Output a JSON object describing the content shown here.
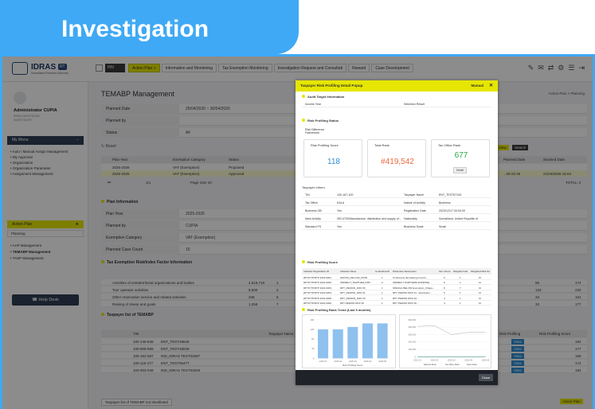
{
  "banner": {
    "title": "Investigation"
  },
  "logo": {
    "name": "IDRAS",
    "badge": "RT",
    "subtitle": "Somaliland Revenue Authority"
  },
  "top_nav": {
    "badge": "INV",
    "tabs": [
      {
        "label": "Action Plan >",
        "active": true
      },
      {
        "label": "Information and Monitoring",
        "active": false
      },
      {
        "label": "Tax Exemption Monitoring",
        "active": false
      },
      {
        "label": "Investigation Request and Consultati",
        "active": false
      },
      {
        "label": "Reward",
        "active": false
      },
      {
        "label": "Case Development",
        "active": false
      }
    ]
  },
  "sidebar": {
    "user_name": "Administrator CUPIA",
    "user_sub": [
      "IDRAS INVESTIGAS",
      "INVESTIGATE"
    ],
    "my_menu": "My Menu",
    "menu_items": [
      "Auto / Manual Assign Management",
      "My Approval",
      "Organization",
      "Organization Parameter",
      "Assignment Management"
    ],
    "action_plan": "Action Plan",
    "planning": "Planning",
    "sub_items": [
      "AAP Management",
      "TEMABP Management",
      "TASP Management"
    ],
    "help_desk": "Help Desk"
  },
  "main": {
    "title": "TEMABP Management",
    "breadcrumb": "Action Plan > Planning",
    "filters": [
      {
        "label": "Planned Date",
        "value": "25/04/2026 ~ 30/04/2026"
      },
      {
        "label": "Planned by",
        "value": ""
      },
      {
        "label": "Status",
        "value": "All"
      }
    ],
    "reset": "Reset",
    "view_btn": "View",
    "search_btn": "Search",
    "grid_headers": [
      "Plan Year",
      "Exemption Category",
      "Status",
      "Planned Date",
      "Stocked Date"
    ],
    "grid_rows": [
      [
        "2025-2026",
        "VAT (Exemption)",
        "Proposed",
        "",
        ""
      ],
      [
        "2025-2026",
        "VAT (Exemption)",
        "Approved",
        "...09 02:45",
        "21/04/2026 15:04"
      ]
    ],
    "pager": "1/1",
    "page_size": "Page Size 10",
    "total": "TOTAL: 2",
    "plan_info_title": "Plan Information",
    "plan_info": [
      {
        "label": "Plan Year",
        "value": "2025-2026"
      },
      {
        "label": "Planned by",
        "value": "CUPIA"
      },
      {
        "label": "Exemption Category",
        "value": "VAT (Exemption)"
      },
      {
        "label": "Planned Case Count",
        "value": "15"
      }
    ],
    "risk_factor_title": "Tax Exemption Risk/Index Factor Information",
    "risk_factors": [
      {
        "name": "Activities of extraterritorial organizations and bodies",
        "v1": "4,516,719",
        "v2": "1",
        "v3": "96",
        "v4": "174"
      },
      {
        "name": "Tour operator activities",
        "v1": "8,830",
        "v2": "2",
        "v3": "132",
        "v4": "232"
      },
      {
        "name": "Other reservation service and related activities",
        "v1": "348",
        "v2": "6",
        "v3": "33",
        "v4": "161"
      },
      {
        "name": "Raising of sheep and goats",
        "v1": "1,258",
        "v2": "7",
        "v3": "33",
        "v4": "177"
      }
    ],
    "taxpayer_title": "Taxpayer list of TEMABP",
    "taxpayer_headers": [
      "TIN",
      "Taxpayer Name",
      "Risk Profiling",
      "Risk Profiling Score"
    ],
    "taxpayers": [
      {
        "tin": "100-146-846",
        "name": "ENT_TEST48846",
        "score": "182"
      },
      {
        "tin": "100-909-899",
        "name": "ENT_TEST48049",
        "score": "177"
      },
      {
        "tin": "100-152-587",
        "name": "IND_IDRAS TEST02587",
        "score": "166"
      },
      {
        "tin": "100-115-477",
        "name": "ENT_TEST06477",
        "score": "174"
      },
      {
        "tin": "103-903-049",
        "name": "IND_IDRAS TEST03049",
        "score": "182"
      }
    ],
    "view_label": "View",
    "bottom_link": "Taxpayer list of TEMABP not shortlisted",
    "action_plan_btn": "Action Plan"
  },
  "modal": {
    "title": "Taxpayer Risk Profiling Detail Popup",
    "help": "Manual",
    "audit_title": "Audit Target Information",
    "audit_fields": [
      {
        "label": "Income Year",
        "value": ""
      },
      {
        "label": "Selection Result",
        "value": ""
      }
    ],
    "risk_status_title": "Risk Profiling Status",
    "diff_label": "Risk Difference Framework",
    "cards": [
      {
        "title": "Risk Profiling Score",
        "value": "118",
        "color": "#2d8fd6"
      },
      {
        "title": "Total Rank",
        "value": "#419,542",
        "color": "#f06a3c"
      },
      {
        "title": "Tax Office Rank",
        "value": "677",
        "color": "#2aa84a"
      }
    ],
    "detail_btn": "Detail",
    "taxpayer_info_title": "Taxpayer Inform",
    "info_rows": [
      [
        "TIN",
        "100-167-100",
        "Taxpayer Name",
        "ENT_TEST67100"
      ],
      [
        "Tax Office",
        "KALA",
        "Nature of Activity",
        "Business"
      ],
      [
        "Business OB",
        "Yes",
        "Registration Date",
        "2023/12/17 00:00:00"
      ],
      [
        "Main Activity",
        "ISIC4700/Manufacture, distribution and supply of...",
        "Nationality",
        "Somaliland, United Republic of"
      ],
      [
        "Standard FS",
        "Yes",
        "Business Scale",
        "Small"
      ]
    ],
    "score_title": "Risk Profiling Score",
    "score_headers": [
      "Indicator Registration ID",
      "Indicator Name",
      "Controlled Response",
      "Parameter Description",
      "Item Score",
      "Weighted Value",
      "Weighted Risk Score"
    ],
    "score_rows": [
      [
        "RPTP.ITP/RTP 2023-0001",
        "GROSS_DECLAR_RATE",
        "1",
        "Continuous decreasing trend fo...",
        "6",
        "1",
        "10"
      ],
      [
        "RPTP.ITP/RTP 2023-0002",
        "INDIRECT_PARTNER_PMT...",
        "0",
        "INDIRECT PARTNERS EXPENSE...",
        "6",
        "1",
        "10"
      ],
      [
        "RPTP.ITP/RTP 2023-0003",
        "RPT_PERIOD_DIFF 06",
        "1",
        "SPECIAL BELOW Exemption_Chapa...",
        "6",
        "7",
        "10"
      ],
      [
        "RPTP.ITP/RTP 2023-0004",
        "RPT_PERIOD_DIFF 01",
        "1",
        "RPT PERIOD DIFF 01 - Exemption...",
        "6",
        "1",
        "10"
      ],
      [
        "RPTP.ITP/RTP 2023-0005",
        "RPT_PERIOD_DIFF 03",
        "1",
        "RPT PERIOD DIFF 03 ...",
        "4",
        "1",
        "10"
      ],
      [
        "RPTP.ITP/RTP 2023-0006",
        "RPT PERIOD DIFF 06",
        "1",
        "RPT PERIOD DIFF 06 ...",
        "4",
        "1",
        "10"
      ]
    ],
    "trend_title": "Risk Profiling Rank Trend (Last 5 months)",
    "close": "Close"
  },
  "chart_data": [
    {
      "type": "bar",
      "categories": [
        "2025.01",
        "2025.02",
        "2025.03",
        "2025.04",
        "2025.05"
      ],
      "series": [
        {
          "name": "Risk Profiling Score",
          "values": [
            120,
            120,
            130,
            145,
            145
          ]
        }
      ],
      "ylim": [
        0,
        160
      ]
    },
    {
      "type": "line",
      "categories": [
        "2025.01",
        "2025.02",
        "2025.03",
        "2025.04",
        "2025.05"
      ],
      "series": [
        {
          "name": "National Rank",
          "values": [
            410000,
            420000,
            300000,
            330000,
            330000
          ]
        },
        {
          "name": "Tax Office Rank",
          "values": [
            690,
            680,
            670,
            660,
            650
          ]
        },
        {
          "name": "Rank Rank",
          "values": [
            500,
            500,
            500,
            500,
            500
          ]
        }
      ],
      "ylim": [
        0,
        500000
      ]
    }
  ]
}
